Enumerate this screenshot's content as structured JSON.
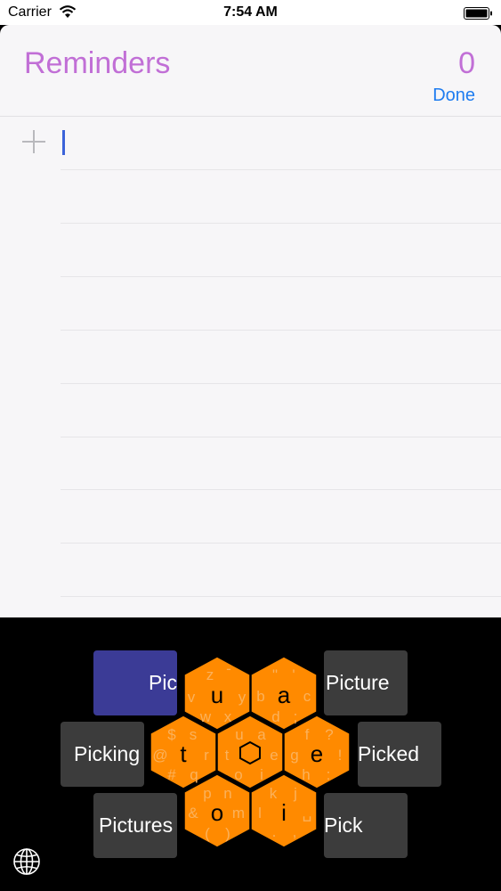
{
  "status_bar": {
    "carrier": "Carrier",
    "time": "7:54 AM",
    "wifi_icon": "wifi-icon",
    "battery_icon": "battery-icon"
  },
  "reminders": {
    "title": "Reminders",
    "count": "0",
    "done_label": "Done",
    "add_icon": "plus-icon",
    "input_value": ""
  },
  "keyboard": {
    "suggestions": {
      "top_left": "Pic",
      "top_right": "Picture",
      "mid_left": "Picking",
      "mid_right": "Picked",
      "bottom_left": "Pictures",
      "bottom_right": "Pick"
    },
    "hex_letters": {
      "top_left": "u",
      "top_right": "a",
      "mid_left": "t",
      "mid_right": "e",
      "bottom_left": "o",
      "bottom_right": "i",
      "center": "hexagon-icon"
    },
    "hex_secondary": {
      "top_left": [
        "z",
        "-",
        "v",
        "y",
        "w",
        "x"
      ],
      "top_right": [
        "\"",
        "'",
        "b",
        "c",
        "d",
        ";"
      ],
      "mid_left": [
        "$",
        "s",
        "@",
        "r",
        "#",
        "q"
      ],
      "center": [
        "u",
        "a",
        "t",
        "e",
        "o",
        "i"
      ],
      "mid_right": [
        "f",
        "?",
        "g",
        "!",
        "h",
        ":"
      ],
      "bottom_left": [
        "p",
        "n",
        "&",
        "m",
        "(",
        ")"
      ],
      "bottom_right": [
        "k",
        "j",
        "l",
        "␣",
        ".",
        ","
      ]
    },
    "accent": "#ff8a00",
    "selected_key_color": "#3b3b96",
    "globe_icon": "globe-icon"
  }
}
